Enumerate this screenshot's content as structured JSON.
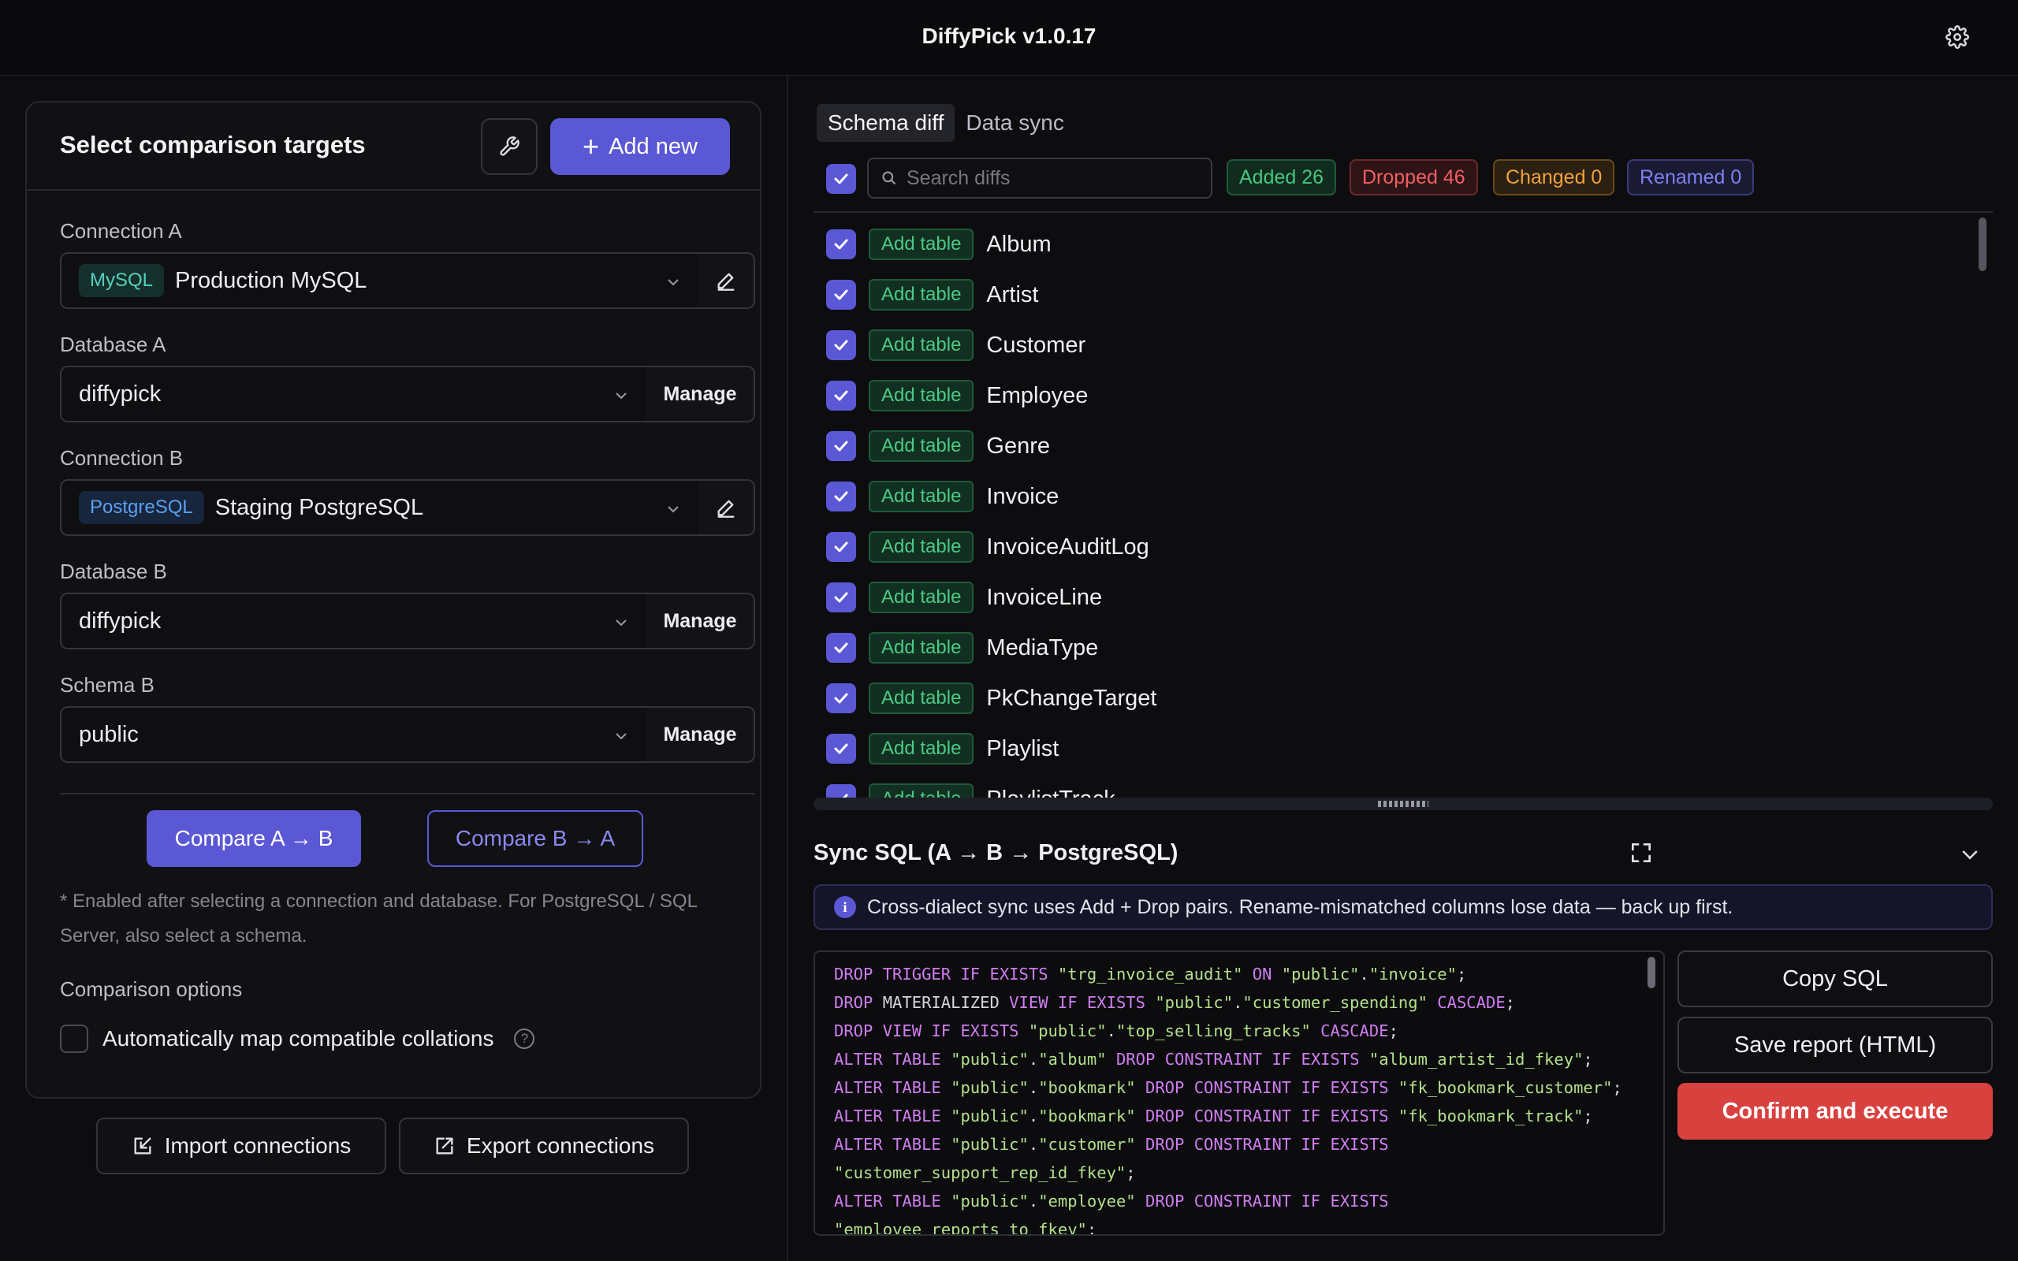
{
  "app": {
    "title": "DiffyPick v1.0.17"
  },
  "left": {
    "card_title": "Select comparison targets",
    "add_new": "Add new",
    "connection_a": {
      "label": "Connection A",
      "dialect": "MySQL",
      "value": "Production MySQL"
    },
    "database_a": {
      "label": "Database A",
      "value": "diffypick",
      "manage": "Manage"
    },
    "connection_b": {
      "label": "Connection B",
      "dialect": "PostgreSQL",
      "value": "Staging PostgreSQL"
    },
    "database_b": {
      "label": "Database B",
      "value": "diffypick",
      "manage": "Manage"
    },
    "schema_b": {
      "label": "Schema B",
      "value": "public",
      "manage": "Manage"
    },
    "compare_ab": "Compare A → B",
    "compare_ba": "Compare B → A",
    "note": "* Enabled after selecting a connection and database. For PostgreSQL / SQL Server, also select a schema.",
    "options_label": "Comparison options",
    "auto_map_label": "Automatically map compatible collations",
    "import": "Import connections",
    "export": "Export connections"
  },
  "right": {
    "tabs": [
      "Schema diff",
      "Data sync"
    ],
    "search_placeholder": "Search diffs",
    "badges": {
      "added": "Added 26",
      "dropped": "Dropped 46",
      "changed": "Changed 0",
      "renamed": "Renamed 0"
    },
    "add_tag": "Add table",
    "rows": [
      "Album",
      "Artist",
      "Customer",
      "Employee",
      "Genre",
      "Invoice",
      "InvoiceAuditLog",
      "InvoiceLine",
      "MediaType",
      "PkChangeTarget",
      "Playlist",
      "PlaylistTrack"
    ],
    "sync_title": "Sync SQL (A → B → PostgreSQL)",
    "info": "Cross-dialect sync uses Add + Drop pairs. Rename-mismatched columns lose data — back up first.",
    "sql_lines": [
      "DROP TRIGGER IF EXISTS \"trg_invoice_audit\" ON \"public\".\"invoice\";",
      "DROP MATERIALIZED VIEW IF EXISTS \"public\".\"customer_spending\" CASCADE;",
      "DROP VIEW IF EXISTS \"public\".\"top_selling_tracks\" CASCADE;",
      "ALTER TABLE \"public\".\"album\" DROP CONSTRAINT IF EXISTS \"album_artist_id_fkey\";",
      "ALTER TABLE \"public\".\"bookmark\" DROP CONSTRAINT IF EXISTS \"fk_bookmark_customer\";",
      "ALTER TABLE \"public\".\"bookmark\" DROP CONSTRAINT IF EXISTS \"fk_bookmark_track\";",
      "ALTER TABLE \"public\".\"customer\" DROP CONSTRAINT IF EXISTS",
      "\"customer_support_rep_id_fkey\";",
      "ALTER TABLE \"public\".\"employee\" DROP CONSTRAINT IF EXISTS",
      "\"employee_reports_to_fkey\";"
    ],
    "copy_sql": "Copy SQL",
    "save_report": "Save report (HTML)",
    "confirm": "Confirm and execute"
  },
  "colors": {
    "accent": "#5b58d6",
    "danger": "#d9413f",
    "added": "#45c77f",
    "dropped": "#f15f62",
    "changed": "#f0a23a",
    "renamed": "#8080f0"
  }
}
